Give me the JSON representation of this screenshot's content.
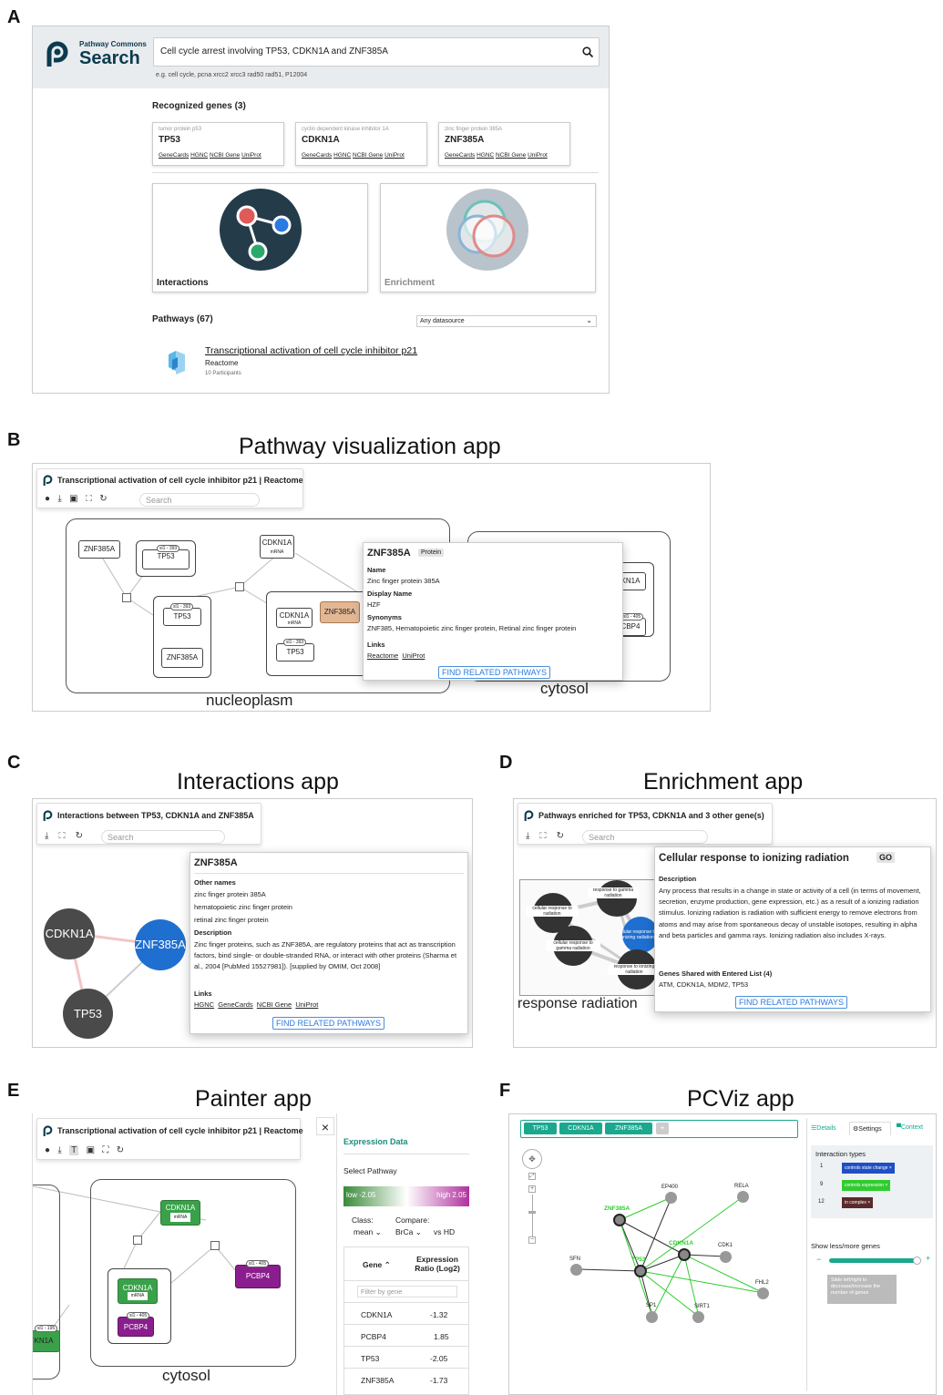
{
  "labels": {
    "a": "A",
    "b": "B",
    "c": "C",
    "d": "D",
    "e": "E",
    "f": "F"
  },
  "titles": {
    "b": "Pathway visualization app",
    "c": "Interactions app",
    "d": "Enrichment app",
    "e": "Painter app",
    "f": "PCViz app"
  },
  "panel_a": {
    "logo_small": "Pathway Commons",
    "logo_big": "Search",
    "search_value": "Cell cycle arrest involving TP53, CDKN1A and ZNF385A",
    "example": "e.g. cell cycle, pcna xrcc2 xrcc3 rad50 rad51, P12004",
    "recognized": "Recognized genes (3)",
    "genes": [
      {
        "desc": "tumor protein p53",
        "name": "TP53",
        "links": [
          "GeneCards",
          "HGNC",
          "NCBI Gene",
          "UniProt"
        ]
      },
      {
        "desc": "cyclin dependent kinase inhibitor 1A",
        "name": "CDKN1A",
        "links": [
          "GeneCards",
          "HGNC",
          "NCBI Gene",
          "UniProt"
        ]
      },
      {
        "desc": "zinc finger protein 385A",
        "name": "ZNF385A",
        "links": [
          "GeneCards",
          "HGNC",
          "NCBI Gene",
          "UniProt"
        ]
      }
    ],
    "interactions": "Interactions",
    "enrichment": "Enrichment",
    "pathways": "Pathways (67)",
    "datasource": "Any datasource",
    "result_title": "Transcriptional activation of cell cycle inhibitor p21",
    "result_source": "Reactome",
    "result_participants": "10 Participants"
  },
  "panel_b": {
    "toolbar_title": "Transcriptional activation of cell cycle inhibitor p21 | Reactome",
    "search_placeholder": "Search",
    "nodes": {
      "znf1": "ZNF385A",
      "tp53a": "TP53",
      "cdkn_top": "CDKN1A",
      "cdkn_top_sub": "mRNA",
      "tp53b": "TP53",
      "znf2": "ZNF385A",
      "cdkn_mid": "CDKN1A",
      "cdkn_mid_sub": "mRNA",
      "znf_hl": "ZNF385A",
      "tp53c": "TP53",
      "cyt1": "KN1A",
      "cyt2": "CBP4",
      "tag1": "sl1 - 393",
      "tag2": "sl1 - 393",
      "tag3": "sl1 - 393",
      "tag4": "sl1 - 405"
    },
    "nucleoplasm": "nucleoplasm",
    "cytosol": "cytosol",
    "popup": {
      "title": "ZNF385A",
      "badge": "Protein",
      "name_h": "Name",
      "name_v": "Zinc finger protein 385A",
      "display_h": "Display Name",
      "display_v": "HZF",
      "syn_h": "Synonyms",
      "syn_v": "ZNF385, Hematopoietic zinc finger protein, Retinal zinc finger protein",
      "links_h": "Links",
      "link1": "Reactome",
      "link2": "UniProt",
      "button": "FIND RELATED PATHWAYS"
    }
  },
  "panel_c": {
    "toolbar_title": "Interactions between TP53, CDKN1A and ZNF385A",
    "search_placeholder": "Search",
    "node_cdkn": "CDKN1A",
    "node_znf": "ZNF385A",
    "node_tp53": "TP53",
    "popup": {
      "title": "ZNF385A",
      "other_h": "Other names",
      "other1": "zinc finger protein 385A",
      "other2": "hematopoietic zinc finger protein",
      "other3": "retinal zinc finger protein",
      "desc_h": "Description",
      "desc_v": "Zinc finger proteins, such as ZNF385A, are regulatory proteins that act as transcription factors, bind single- or double-stranded RNA, or interact with other proteins (Sharma et al., 2004 [PubMed 15527981]). [supplied by OMIM, Oct 2008]",
      "links_h": "Links",
      "links": [
        "HGNC",
        "GeneCards",
        "NCBI Gene",
        "UniProt"
      ],
      "button": "FIND RELATED PATHWAYS"
    }
  },
  "panel_d": {
    "toolbar_title": "Pathways enriched for TP53, CDKN1A and 3 other gene(s)",
    "search_placeholder": "Search",
    "nodes": {
      "n1": "cellular response to radiation",
      "n2": "response to gamma radiation",
      "n3": "cellular response to gamma radiation",
      "n4": "cellular response to ionizing radiation",
      "n5": "response to ionizing radiation"
    },
    "bottom_text": "response radiation",
    "popup": {
      "title": "Cellular response to ionizing radiation",
      "badge": "GO",
      "desc_h": "Description",
      "desc_v": "Any process that results in a change in state or activity of a cell (in terms of movement, secretion, enzyme production, gene expression, etc.) as a result of a ionizing radiation stimulus. Ionizing radiation is radiation with sufficient energy to remove electrons from atoms and may arise from spontaneous decay of unstable isotopes, resulting in alpha and beta particles and gamma rays. Ionizing radiation also includes X-rays.",
      "shared_h": "Genes Shared with Entered List (4)",
      "shared_v": "ATM, CDKN1A, MDM2, TP53",
      "button": "FIND RELATED PATHWAYS"
    }
  },
  "panel_e": {
    "toolbar_title": "Transcriptional activation of cell cycle inhibitor p21 | Reactome",
    "close": "×",
    "nodes": {
      "cdkn_top": "CDKN1A",
      "cdkn_top_sub": "mRNA",
      "cdkn_mid": "CDKN1A",
      "cdkn_mid_sub": "mRNA",
      "pcbp_in": "PCBP4",
      "pcbp_out": "PCBP4",
      "left": "KN1A",
      "tag1": "sl1 - 405",
      "tag2": "sl1 - 405",
      "tag3": "sl1 - 195"
    },
    "cytosol": "cytosol",
    "sidebar": {
      "heading": "Expression Data",
      "select_pathway": "Select Pathway",
      "low": "low -2.05",
      "high": "high 2.05",
      "class_h": "Class:",
      "class_v": "mean",
      "compare_h": "Compare:",
      "compare_v": "BrCa",
      "vs": "vs HD",
      "col_gene": "Gene",
      "col_ratio": "Expression Ratio (Log2)",
      "filter_placeholder": "Filter by gene",
      "rows": [
        {
          "gene": "CDKN1A",
          "value": "-1.32"
        },
        {
          "gene": "PCBP4",
          "value": "1.85"
        },
        {
          "gene": "TP53",
          "value": "-2.05"
        },
        {
          "gene": "ZNF385A",
          "value": "-1.73"
        }
      ]
    }
  },
  "panel_f": {
    "tags": [
      "TP53",
      "CDKN1A",
      "ZNF385A"
    ],
    "plus": "+",
    "tabs": {
      "details": "Details",
      "settings": "Settings",
      "context": "Context"
    },
    "interaction_types": "Interaction types",
    "types": [
      {
        "count": "1",
        "label": "controls state change ×",
        "color": "#1f4fc4"
      },
      {
        "count": "9",
        "label": "controls expression ×",
        "color": "#2ecc2e"
      },
      {
        "count": "12",
        "label": "in complex ×",
        "color": "#5a2a2a"
      }
    ],
    "show_genes": "Show less/more genes",
    "minus": "−",
    "plus2": "+",
    "slider_tip": "Slide left/right to decrease/increase the number of genes",
    "nodes": {
      "ep400": "EP400",
      "rela": "RELA",
      "znf": "ZNF385A",
      "cdkn": "CDKN1A",
      "cdk1": "CDK1",
      "sfn": "SFN",
      "tp53": "TP53",
      "fhl2": "FHL2",
      "sp1": "SP1",
      "sirt1": "SIRT1"
    }
  }
}
